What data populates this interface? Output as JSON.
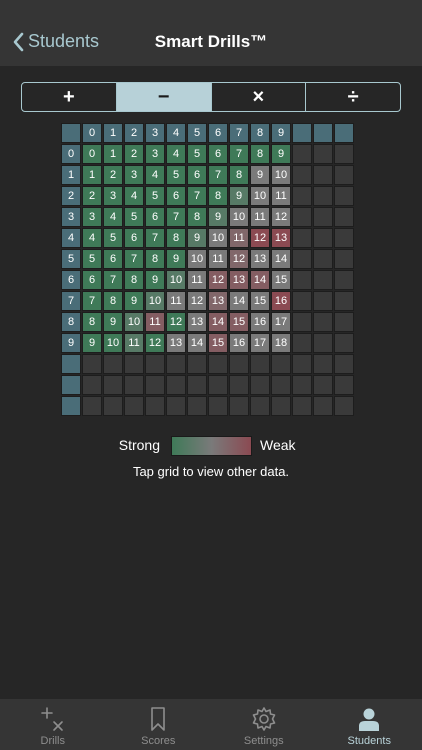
{
  "nav": {
    "back_label": "Students",
    "title": "Smart Drills™"
  },
  "operations": [
    {
      "symbol": "+",
      "active": false
    },
    {
      "symbol": "−",
      "active": true
    },
    {
      "symbol": "×",
      "active": false
    },
    {
      "symbol": "÷",
      "active": false
    }
  ],
  "grid": {
    "col_headers": [
      "0",
      "1",
      "2",
      "3",
      "4",
      "5",
      "6",
      "7",
      "8",
      "9",
      "",
      "",
      ""
    ],
    "row_headers": [
      "0",
      "1",
      "2",
      "3",
      "4",
      "5",
      "6",
      "7",
      "8",
      "9",
      "",
      "",
      ""
    ],
    "rows": [
      [
        0,
        1,
        2,
        3,
        4,
        5,
        6,
        7,
        8,
        9
      ],
      [
        1,
        2,
        3,
        4,
        5,
        6,
        7,
        8,
        9,
        10
      ],
      [
        2,
        3,
        4,
        5,
        6,
        7,
        8,
        9,
        10,
        11
      ],
      [
        3,
        4,
        5,
        6,
        7,
        8,
        9,
        10,
        11,
        12
      ],
      [
        4,
        5,
        6,
        7,
        8,
        9,
        10,
        11,
        12,
        13
      ],
      [
        5,
        6,
        7,
        8,
        9,
        10,
        11,
        12,
        13,
        14
      ],
      [
        6,
        7,
        8,
        9,
        10,
        11,
        12,
        13,
        14,
        15
      ],
      [
        7,
        8,
        9,
        10,
        11,
        12,
        13,
        14,
        15,
        16
      ],
      [
        8,
        9,
        10,
        11,
        12,
        13,
        14,
        15,
        16,
        17
      ],
      [
        9,
        10,
        11,
        12,
        13,
        14,
        15,
        16,
        17,
        18
      ]
    ],
    "weakness": [
      [
        0,
        0,
        0,
        0,
        0,
        0,
        0,
        0,
        0,
        0
      ],
      [
        0,
        0,
        0,
        0,
        0,
        0,
        0,
        0,
        0.5,
        0.5
      ],
      [
        0,
        0,
        0,
        0,
        0,
        0,
        0,
        0.2,
        0.5,
        0.5
      ],
      [
        0,
        0,
        0,
        0,
        0,
        0,
        0.2,
        0.5,
        0.5,
        0.5
      ],
      [
        0,
        0,
        0,
        0,
        0,
        0.2,
        0.5,
        0.7,
        1,
        1
      ],
      [
        0,
        0,
        0,
        0,
        0,
        0.5,
        0.5,
        0.7,
        0.5,
        0.5
      ],
      [
        0,
        0,
        0,
        0,
        0.2,
        0.5,
        0.8,
        0.8,
        0.8,
        0.5
      ],
      [
        0,
        0,
        0,
        0.2,
        0.5,
        0.5,
        0.7,
        0.5,
        0.5,
        1
      ],
      [
        0,
        0,
        0.2,
        0.8,
        0,
        0.5,
        0.8,
        0.8,
        0.5,
        0.5
      ],
      [
        0,
        0,
        0.2,
        0,
        0.5,
        0.5,
        0.8,
        0.5,
        0.5,
        0.5
      ]
    ],
    "colors": {
      "header": "#4a6d78",
      "empty": "#3a3a3a",
      "strong": "#3f7a58",
      "mid": "#7a7a7a",
      "weak": "#8b4a52"
    }
  },
  "legend": {
    "strong_label": "Strong",
    "weak_label": "Weak"
  },
  "hint": "Tap grid to view other data.",
  "tabs": [
    {
      "label": "Drills",
      "icon": "drills-icon",
      "active": false
    },
    {
      "label": "Scores",
      "icon": "bookmark-icon",
      "active": false
    },
    {
      "label": "Settings",
      "icon": "gear-icon",
      "active": false
    },
    {
      "label": "Students",
      "icon": "person-icon",
      "active": true
    }
  ]
}
